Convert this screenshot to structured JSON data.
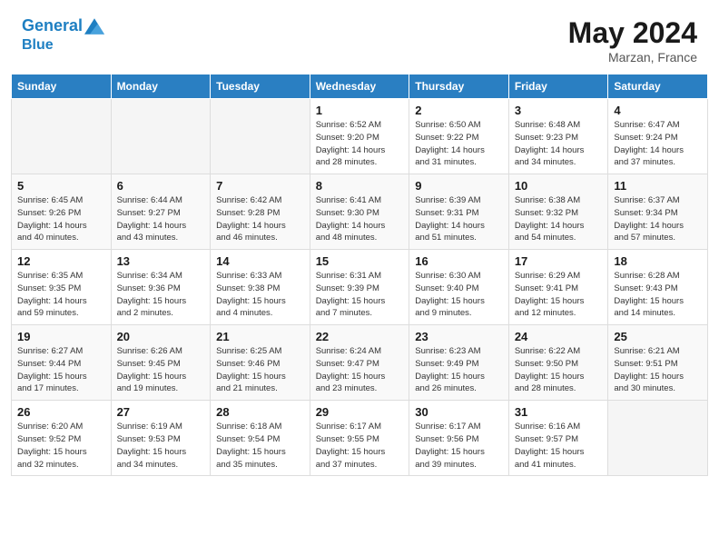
{
  "header": {
    "logo_line1": "General",
    "logo_line2": "Blue",
    "month_year": "May 2024",
    "location": "Marzan, France"
  },
  "days_of_week": [
    "Sunday",
    "Monday",
    "Tuesday",
    "Wednesday",
    "Thursday",
    "Friday",
    "Saturday"
  ],
  "weeks": [
    [
      {
        "num": "",
        "info": ""
      },
      {
        "num": "",
        "info": ""
      },
      {
        "num": "",
        "info": ""
      },
      {
        "num": "1",
        "info": "Sunrise: 6:52 AM\nSunset: 9:20 PM\nDaylight: 14 hours\nand 28 minutes."
      },
      {
        "num": "2",
        "info": "Sunrise: 6:50 AM\nSunset: 9:22 PM\nDaylight: 14 hours\nand 31 minutes."
      },
      {
        "num": "3",
        "info": "Sunrise: 6:48 AM\nSunset: 9:23 PM\nDaylight: 14 hours\nand 34 minutes."
      },
      {
        "num": "4",
        "info": "Sunrise: 6:47 AM\nSunset: 9:24 PM\nDaylight: 14 hours\nand 37 minutes."
      }
    ],
    [
      {
        "num": "5",
        "info": "Sunrise: 6:45 AM\nSunset: 9:26 PM\nDaylight: 14 hours\nand 40 minutes."
      },
      {
        "num": "6",
        "info": "Sunrise: 6:44 AM\nSunset: 9:27 PM\nDaylight: 14 hours\nand 43 minutes."
      },
      {
        "num": "7",
        "info": "Sunrise: 6:42 AM\nSunset: 9:28 PM\nDaylight: 14 hours\nand 46 minutes."
      },
      {
        "num": "8",
        "info": "Sunrise: 6:41 AM\nSunset: 9:30 PM\nDaylight: 14 hours\nand 48 minutes."
      },
      {
        "num": "9",
        "info": "Sunrise: 6:39 AM\nSunset: 9:31 PM\nDaylight: 14 hours\nand 51 minutes."
      },
      {
        "num": "10",
        "info": "Sunrise: 6:38 AM\nSunset: 9:32 PM\nDaylight: 14 hours\nand 54 minutes."
      },
      {
        "num": "11",
        "info": "Sunrise: 6:37 AM\nSunset: 9:34 PM\nDaylight: 14 hours\nand 57 minutes."
      }
    ],
    [
      {
        "num": "12",
        "info": "Sunrise: 6:35 AM\nSunset: 9:35 PM\nDaylight: 14 hours\nand 59 minutes."
      },
      {
        "num": "13",
        "info": "Sunrise: 6:34 AM\nSunset: 9:36 PM\nDaylight: 15 hours\nand 2 minutes."
      },
      {
        "num": "14",
        "info": "Sunrise: 6:33 AM\nSunset: 9:38 PM\nDaylight: 15 hours\nand 4 minutes."
      },
      {
        "num": "15",
        "info": "Sunrise: 6:31 AM\nSunset: 9:39 PM\nDaylight: 15 hours\nand 7 minutes."
      },
      {
        "num": "16",
        "info": "Sunrise: 6:30 AM\nSunset: 9:40 PM\nDaylight: 15 hours\nand 9 minutes."
      },
      {
        "num": "17",
        "info": "Sunrise: 6:29 AM\nSunset: 9:41 PM\nDaylight: 15 hours\nand 12 minutes."
      },
      {
        "num": "18",
        "info": "Sunrise: 6:28 AM\nSunset: 9:43 PM\nDaylight: 15 hours\nand 14 minutes."
      }
    ],
    [
      {
        "num": "19",
        "info": "Sunrise: 6:27 AM\nSunset: 9:44 PM\nDaylight: 15 hours\nand 17 minutes."
      },
      {
        "num": "20",
        "info": "Sunrise: 6:26 AM\nSunset: 9:45 PM\nDaylight: 15 hours\nand 19 minutes."
      },
      {
        "num": "21",
        "info": "Sunrise: 6:25 AM\nSunset: 9:46 PM\nDaylight: 15 hours\nand 21 minutes."
      },
      {
        "num": "22",
        "info": "Sunrise: 6:24 AM\nSunset: 9:47 PM\nDaylight: 15 hours\nand 23 minutes."
      },
      {
        "num": "23",
        "info": "Sunrise: 6:23 AM\nSunset: 9:49 PM\nDaylight: 15 hours\nand 26 minutes."
      },
      {
        "num": "24",
        "info": "Sunrise: 6:22 AM\nSunset: 9:50 PM\nDaylight: 15 hours\nand 28 minutes."
      },
      {
        "num": "25",
        "info": "Sunrise: 6:21 AM\nSunset: 9:51 PM\nDaylight: 15 hours\nand 30 minutes."
      }
    ],
    [
      {
        "num": "26",
        "info": "Sunrise: 6:20 AM\nSunset: 9:52 PM\nDaylight: 15 hours\nand 32 minutes."
      },
      {
        "num": "27",
        "info": "Sunrise: 6:19 AM\nSunset: 9:53 PM\nDaylight: 15 hours\nand 34 minutes."
      },
      {
        "num": "28",
        "info": "Sunrise: 6:18 AM\nSunset: 9:54 PM\nDaylight: 15 hours\nand 35 minutes."
      },
      {
        "num": "29",
        "info": "Sunrise: 6:17 AM\nSunset: 9:55 PM\nDaylight: 15 hours\nand 37 minutes."
      },
      {
        "num": "30",
        "info": "Sunrise: 6:17 AM\nSunset: 9:56 PM\nDaylight: 15 hours\nand 39 minutes."
      },
      {
        "num": "31",
        "info": "Sunrise: 6:16 AM\nSunset: 9:57 PM\nDaylight: 15 hours\nand 41 minutes."
      },
      {
        "num": "",
        "info": ""
      }
    ]
  ]
}
